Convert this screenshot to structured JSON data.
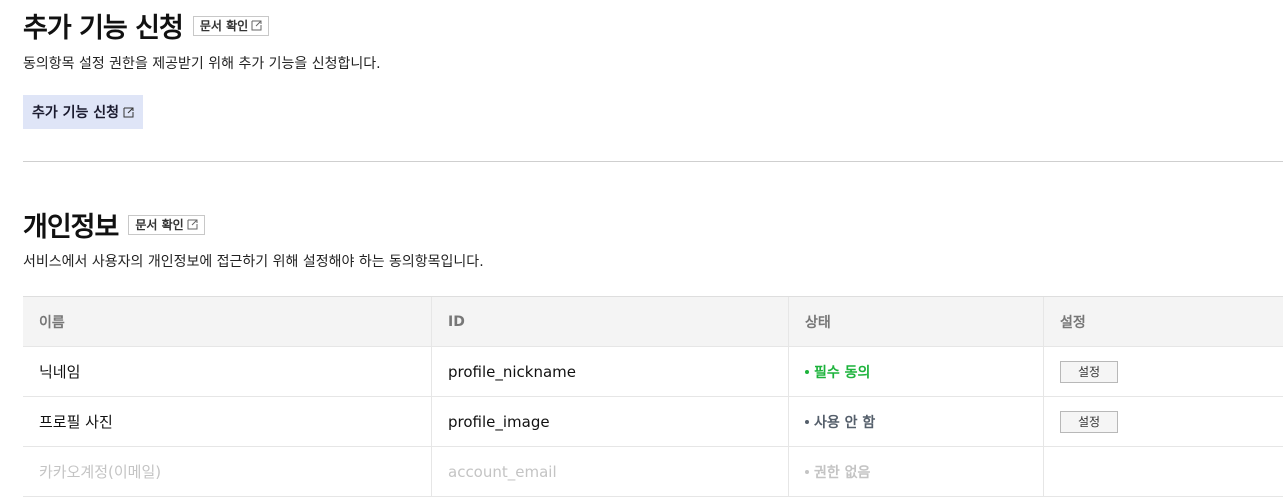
{
  "addon": {
    "title": "추가 기능 신청",
    "doc_button": "문서 확인",
    "description": "동의항목 설정 권한을 제공받기 위해 추가 기능을 신청합니다.",
    "apply_button": "추가 기능 신청"
  },
  "privacy": {
    "title": "개인정보",
    "doc_button": "문서 확인",
    "description": "서비스에서 사용자의 개인정보에 접근하기 위해 설정해야 하는 동의항목입니다."
  },
  "table": {
    "headers": [
      "이름",
      "ID",
      "상태",
      "설정"
    ],
    "rows": [
      {
        "name": "닉네임",
        "id": "profile_nickname",
        "status": "필수 동의",
        "status_color": "#1db33c",
        "setting": "설정",
        "disabled": false
      },
      {
        "name": "프로필 사진",
        "id": "profile_image",
        "status": "사용 안 함",
        "status_color": "#555f6b",
        "setting": "설정",
        "disabled": false
      },
      {
        "name": "카카오계정(이메일)",
        "id": "account_email",
        "status": "권한 없음",
        "status_color": "#c4c4c4",
        "setting": "",
        "disabled": true
      }
    ]
  },
  "colors": {
    "apply_bg": "#dfe5f7",
    "header_bg": "#f4f4f4"
  }
}
